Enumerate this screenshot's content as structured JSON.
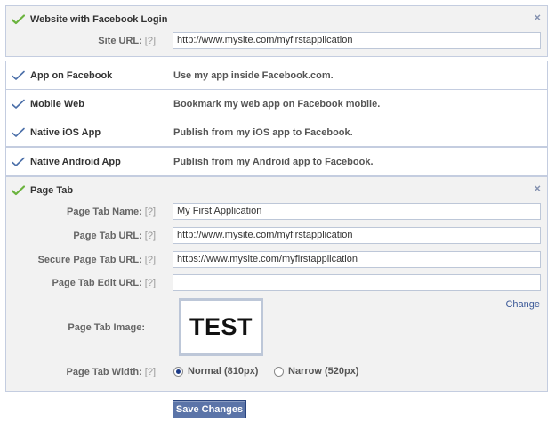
{
  "website_login": {
    "title": "Website with Facebook Login",
    "close": "×",
    "site_url": {
      "label": "Site URL:",
      "help": "[?]",
      "value": "http://www.mysite.com/myfirstapplication"
    }
  },
  "integrations": [
    {
      "title": "App on Facebook",
      "desc": "Use my app inside Facebook.com."
    },
    {
      "title": "Mobile Web",
      "desc": "Bookmark my web app on Facebook mobile."
    },
    {
      "title": "Native iOS App",
      "desc": "Publish from my iOS app to Facebook."
    },
    {
      "title": "Native Android App",
      "desc": "Publish from my Android app to Facebook."
    }
  ],
  "page_tab": {
    "title": "Page Tab",
    "close": "×",
    "name": {
      "label": "Page Tab Name:",
      "help": "[?]",
      "value": "My First Application"
    },
    "url": {
      "label": "Page Tab URL:",
      "help": "[?]",
      "value": "http://www.mysite.com/myfirstapplication"
    },
    "secure_url": {
      "label": "Secure Page Tab URL:",
      "help": "[?]",
      "value": "https://www.mysite.com/myfirstapplication"
    },
    "edit_url": {
      "label": "Page Tab Edit URL:",
      "help": "[?]",
      "value": ""
    },
    "image": {
      "label": "Page Tab Image:",
      "text": "TEST",
      "change": "Change"
    },
    "width": {
      "label": "Page Tab Width:",
      "help": "[?]",
      "options": [
        {
          "label": "Normal (810px)",
          "selected": true
        },
        {
          "label": "Narrow (520px)",
          "selected": false
        }
      ]
    }
  },
  "save_label": "Save Changes",
  "colors": {
    "accent": "#3b5998",
    "check_done": "#6bb33e",
    "check_pending": "#4a6ea8",
    "border": "#c4cde0"
  }
}
